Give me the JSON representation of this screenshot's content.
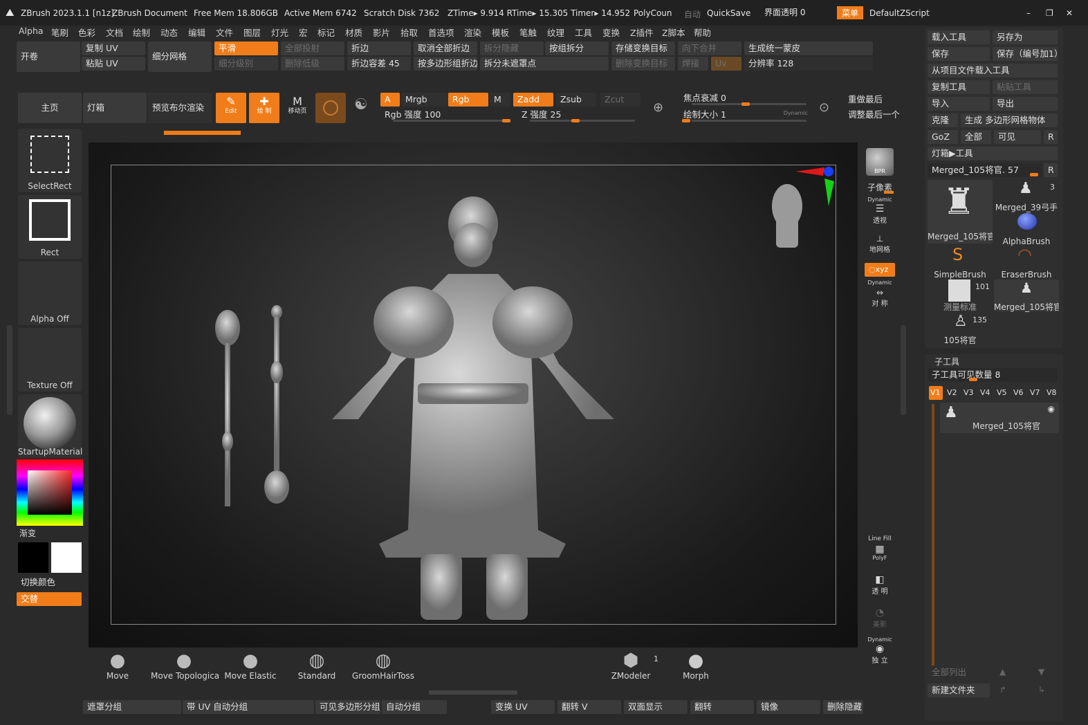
{
  "title_bar": {
    "app": "ZBrush 2023.1.1 [n1z]",
    "document": "ZBrush Document",
    "free_mem": "Free Mem 18.806GB",
    "active_mem": "Active Mem 6742",
    "scratch": "Scratch Disk 7362",
    "ztime": "ZTime▸ 9.914 RTime▸ 15.305 Timer▸ 14.952",
    "polycount": "PolyCoun",
    "auto": "自动",
    "quicksave": "QuickSave",
    "transparency": "界面透明 0",
    "menu": "菜单",
    "script": "DefaultZScript"
  },
  "menu": [
    "Alpha",
    "笔刷",
    "色彩",
    "文档",
    "绘制",
    "动态",
    "编辑",
    "文件",
    "图层",
    "灯光",
    "宏",
    "标记",
    "材质",
    "影片",
    "拾取",
    "首选项",
    "渲染",
    "模板",
    "笔触",
    "纹理",
    "工具",
    "变换",
    "Z插件",
    "Z脚本",
    "帮助"
  ],
  "toolbar1": {
    "open": "开卷",
    "copy_uv": "复制 UV",
    "paste_uv": "粘贴 UV",
    "subdivide": "细分网格",
    "smooth": "平滑",
    "all_project": "全部投射",
    "sub_level": "细分级别",
    "del_lower": "删除低级",
    "crease": "折边",
    "crease_tol": "折边容差 45",
    "uncrease_all": "取消全部折边",
    "split_hidden": "拆分隐藏",
    "by_group_split": "按组拆分",
    "by_poly_crease": "按多边形组折边",
    "split_unmasked": "拆分未遮罩点",
    "store_morph": "存储变换目标",
    "del_morph": "删除变换目标",
    "merge_down": "向下合并",
    "weld": "焊接",
    "uv": "Uv",
    "unified_skin": "生成统一蒙皮",
    "resolution": "分辨率 128"
  },
  "toolbar2": {
    "home": "主页",
    "lightbox": "灯箱",
    "preview_bool": "预览布尔渲染",
    "edit": "Edit",
    "draw": "绘 制",
    "move": "移动页",
    "a": "A",
    "mrgb": "Mrgb",
    "rgb": "Rgb",
    "m": "M",
    "zadd": "Zadd",
    "zsub": "Zsub",
    "zcut": "Zcut",
    "rgb_intensity": "Rgb 强度 100",
    "z_intensity": "Z 强度 25",
    "focal": "焦点衰减 0",
    "draw_size": "绘制大小 1",
    "dynamic": "Dynamic",
    "redo_last": "重做最后",
    "adjust_last": "调整最后一个"
  },
  "left_shelf": {
    "select_rect": "SelectRect",
    "rect": "Rect",
    "alpha_off": "Alpha Off",
    "texture_off": "Texture Off",
    "material": "StartupMaterial",
    "gradient": "渐变",
    "switch_color": "切换颜色",
    "alternate": "交替"
  },
  "right_shelf": {
    "bpr": "BPR",
    "subpixel": "子像素",
    "dynamic": "Dynamic",
    "persp": "透视",
    "floor": "地网格",
    "xyz": "◌xyz",
    "sym": "对 称",
    "line_fill": "Line Fill",
    "polyf": "PolyF",
    "transp": "透 明",
    "ghost": "美影",
    "solo": "独 立"
  },
  "tool_panel": {
    "load_tool": "载入工具",
    "save_as": "另存为",
    "save": "保存",
    "save_inc": "保存（编号加1）",
    "load_from_project": "从项目文件载入工具",
    "copy_tool": "复制工具",
    "paste_tool": "粘贴工具",
    "import": "导入",
    "export": "导出",
    "clone": "克隆",
    "make_polymesh": "生成 多边形网格物体",
    "goz": "GoZ",
    "all": "全部",
    "visible": "可见",
    "r": "R",
    "lightbox_tools": "灯箱▶工具",
    "current_tool": "Merged_105将官. 57",
    "thumbs": [
      {
        "label": "Merged_105将官",
        "count": ""
      },
      {
        "label": "Merged_39弓手",
        "count": "3"
      },
      {
        "label": "AlphaBrush",
        "count": ""
      },
      {
        "label": "SimpleBrush",
        "count": ""
      },
      {
        "label": "EraserBrush",
        "count": ""
      },
      {
        "label": "测量标准",
        "count": "101"
      },
      {
        "label": "Merged_105将官",
        "count": ""
      },
      {
        "label": "105将官",
        "count": "135"
      }
    ]
  },
  "subtool_panel": {
    "header": "子工具",
    "visible_count": "子工具可见数量 8",
    "versions": [
      "V1",
      "V2",
      "V3",
      "V4",
      "V5",
      "V6",
      "V7",
      "V8"
    ],
    "item": "Merged_105将官",
    "list_all": "全部列出",
    "new_folder": "新建文件夹"
  },
  "brushes": [
    "Move",
    "Move Topologica",
    "Move Elastic",
    "Standard",
    "GroomHairToss",
    "ZModeler",
    "Morph"
  ],
  "zmodeler_count": "1",
  "bottom_bar": [
    "遮罩分组",
    "带 UV 自动分组",
    "可见多边形分组",
    "自动分组",
    "变换 UV",
    "翻转 V",
    "双面显示",
    "翻转",
    "镜像",
    "删除隐藏"
  ],
  "colors": {
    "accent": "#f07d1a",
    "bg": "#2a2a2a",
    "button": "#3a3a3a"
  }
}
